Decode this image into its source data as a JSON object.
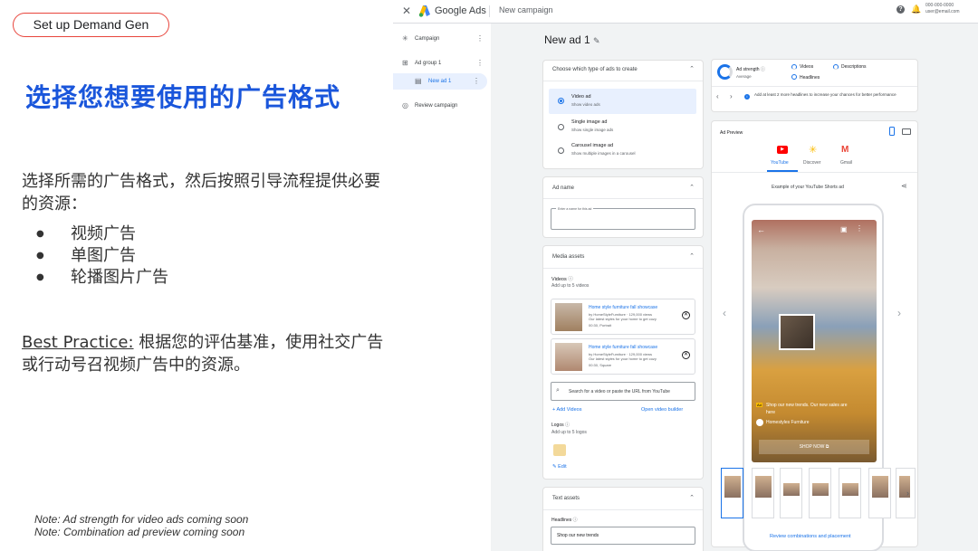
{
  "slide": {
    "pill": "Set up Demand Gen",
    "title": "选择您想要使用的广告格式",
    "description": "选择所需的广告格式，然后按照引导流程提供必要的资源：",
    "bullets": [
      "视频广告",
      "单图广告",
      "轮播图片广告"
    ],
    "best_practice_label": "Best Practice:",
    "best_practice_text": " 根据您的评估基准，使用社交广告或行动号召视频广告中的资源。",
    "note1": "Note: Ad strength for video ads coming soon",
    "note2": "Note: Combination ad preview coming soon"
  },
  "topbar": {
    "close": "✕",
    "app": "Google Ads",
    "crumb": "New campaign",
    "help": "?",
    "account_line1": "000-000-0000",
    "account_line2": "user@email.com"
  },
  "nav": {
    "campaign": "Campaign",
    "ad_group": "Ad group 1",
    "new_ad": "New ad 1",
    "review": "Review campaign"
  },
  "editor": {
    "title": "New ad 1",
    "type_card": {
      "header": "Choose which type of ads to create",
      "options": [
        {
          "title": "Video ad",
          "sub": "Show video ads",
          "selected": true
        },
        {
          "title": "Single image ad",
          "sub": "Show single image ads",
          "selected": false
        },
        {
          "title": "Carousel image ad",
          "sub": "Show multiple images in a carousel",
          "selected": false
        }
      ]
    },
    "ad_name": {
      "header": "Ad name",
      "placeholder": "Enter a name for this ad"
    },
    "media": {
      "header": "Media assets",
      "videos_label": "Videos",
      "videos_sub": "Add up to 5 videos",
      "videos": [
        {
          "title": "Home style furniture fall showcase",
          "by": "by HomeStyleFurniture · 129,000 views",
          "desc": "Our latest styles for your home to get cozy",
          "meta": "00:30, Portrait"
        },
        {
          "title": "Home style furniture fall showcase",
          "by": "by HomeStyleFurniture · 129,000 views",
          "desc": "Our latest styles for your home to get cozy",
          "meta": "00:30, Square"
        }
      ],
      "search_placeholder": "Search for a video or paste the URL from YouTube",
      "add_videos": "Add Videos",
      "open_builder": "Open video builder",
      "logos_label": "Logos",
      "logos_sub": "Add up to 5 logos",
      "edit": "Edit"
    },
    "text_assets": {
      "header": "Text assets",
      "headlines_label": "Headlines",
      "headline_value": "Shop our new trends"
    }
  },
  "strength": {
    "label": "Ad strength",
    "value": "Average",
    "videos": "Videos",
    "descriptions": "Descriptions",
    "headlines": "Headlines",
    "tip": "Add at least 2 more headlines to increase your chances for better performance"
  },
  "preview": {
    "header": "Ad Preview",
    "tabs": [
      "YouTube",
      "Discover",
      "Gmail"
    ],
    "example": "Example of your YouTube Shorts ad",
    "ad_badge": "Ad",
    "ad_text": "Shop our new trends. Our new sales are here",
    "brand": "Homestyles Furniture",
    "cta": "SHOP NOW",
    "review_link": "Review combinations and placement"
  },
  "colors": {
    "accent": "#1a73e8",
    "title_blue": "#1a56db",
    "pill_border": "#e8453c"
  }
}
